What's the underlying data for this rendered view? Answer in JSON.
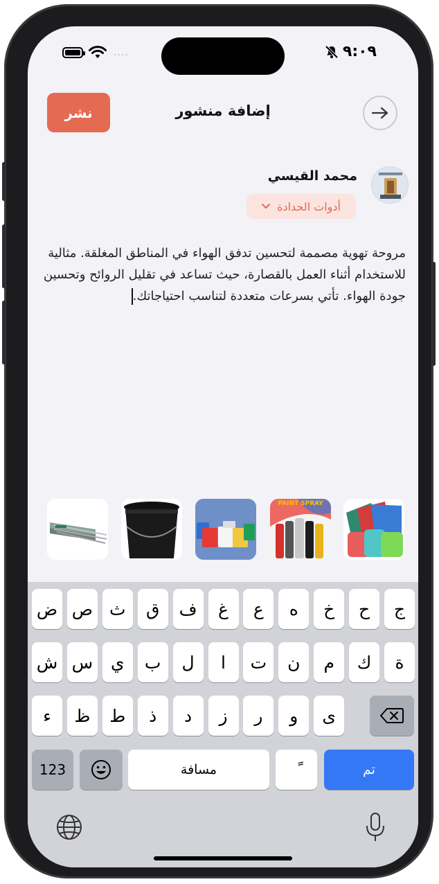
{
  "status_bar": {
    "time": "٩:٠٩",
    "dots": "....",
    "icons": [
      "battery-icon",
      "wifi-icon",
      "bell-slash-icon"
    ]
  },
  "header": {
    "publish_label": "نشر",
    "title": "إضافة منشور",
    "back_icon": "arrow-right-icon"
  },
  "post": {
    "author": "محمد القيسي",
    "category": "أدوات الحدادة",
    "text": "مروحة تهوية مصممة لتحسين تدفق الهواء في المناطق المغلقة. مثالية للاستخدام أثناء العمل بالقصارة، حيث تساعد في تقليل الروائح وتحسين جودة الهواء. تأتي بسرعات متعددة لتناسب احتياجاتك."
  },
  "thumbnails": [
    {
      "name": "welding-rods-image"
    },
    {
      "name": "black-bucket-image"
    },
    {
      "name": "paint-buckets-image"
    },
    {
      "name": "spray-paint-image",
      "caption": "PAINT SPRAY"
    },
    {
      "name": "putty-spatulas-image"
    }
  ],
  "keyboard": {
    "row1": [
      "ض",
      "ص",
      "ث",
      "ق",
      "ف",
      "غ",
      "ع",
      "ه",
      "خ",
      "ح",
      "ج"
    ],
    "row2": [
      "ش",
      "س",
      "ي",
      "ب",
      "ل",
      "ا",
      "ت",
      "ن",
      "م",
      "ك",
      "ة"
    ],
    "row3": [
      "ء",
      "ظ",
      "ط",
      "ذ",
      "د",
      "ز",
      "ر",
      "و",
      "ى"
    ],
    "numbers_label": "123",
    "space_label": "مسافة",
    "tanween_label": "ً",
    "done_label": "تم",
    "colors": {
      "done": "#3478f6",
      "publish": "#e56a52"
    }
  }
}
